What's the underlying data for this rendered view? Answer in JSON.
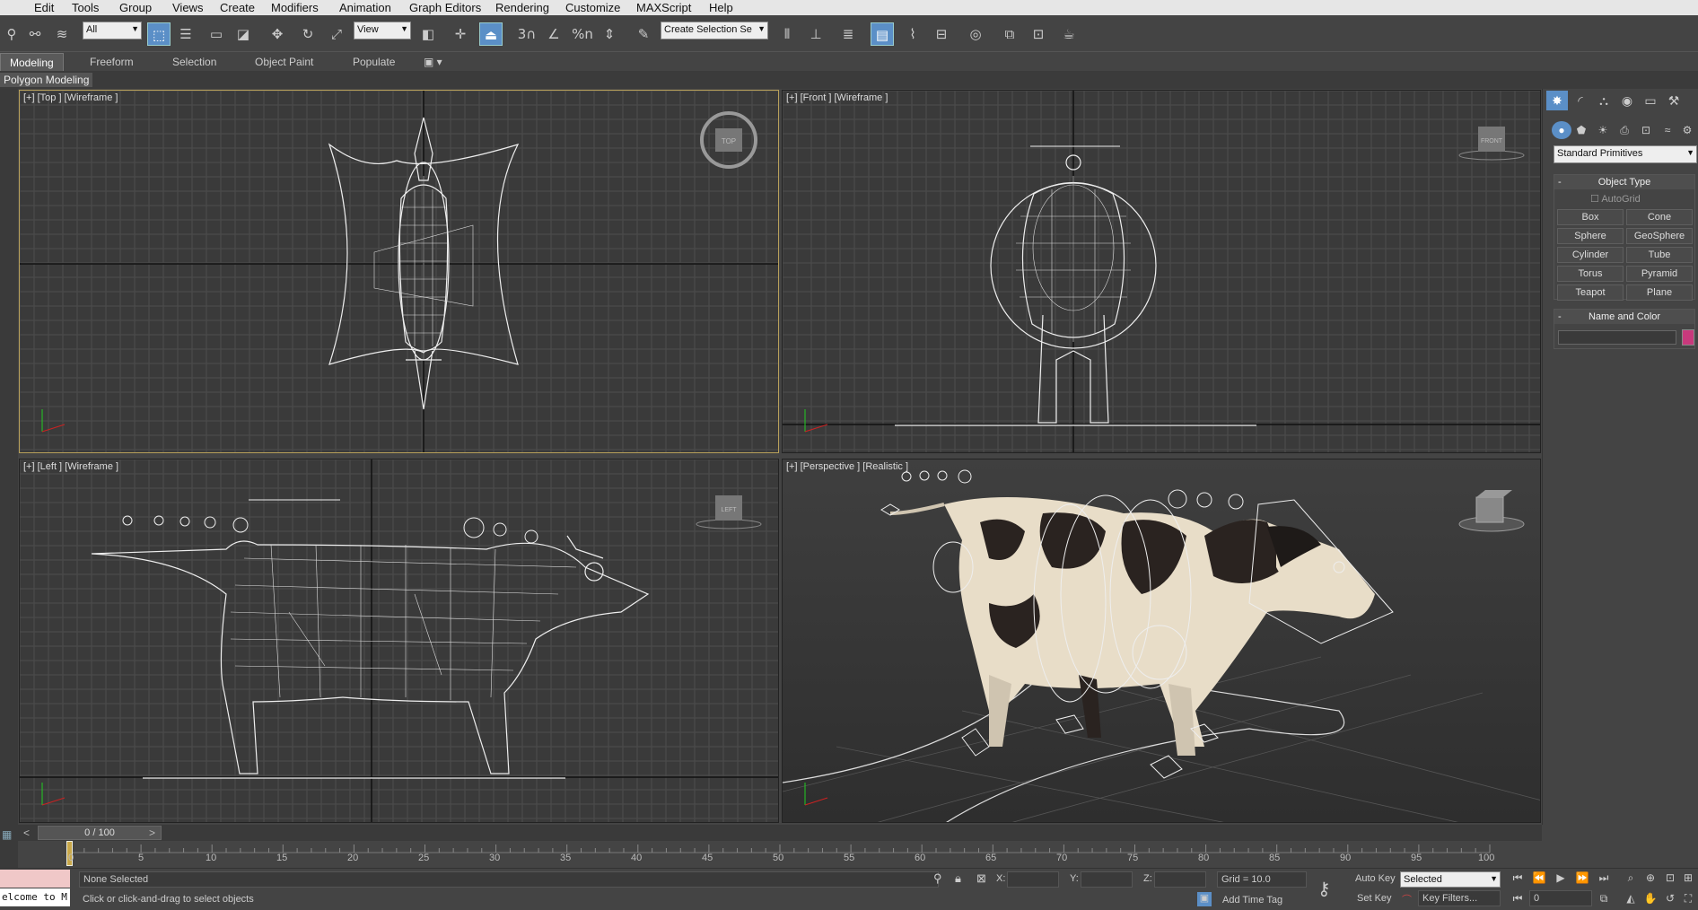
{
  "menu": [
    "Edit",
    "Tools",
    "Group",
    "Views",
    "Create",
    "Modifiers",
    "Animation",
    "Graph Editors",
    "Rendering",
    "Customize",
    "MAXScript",
    "Help"
  ],
  "toolbar": {
    "selection_filter": "All",
    "ref_coord": "View",
    "selection_set_placeholder": "Create Selection Se",
    "snap_label": "3",
    "percent_label": "%n"
  },
  "ribbon": {
    "tabs": [
      "Modeling",
      "Freeform",
      "Selection",
      "Object Paint",
      "Populate"
    ],
    "subpanel": "Polygon Modeling"
  },
  "viewports": {
    "top": {
      "label": "[+] [Top ] [Wireframe ]",
      "cube": "TOP"
    },
    "front": {
      "label": "[+] [Front ] [Wireframe ]",
      "cube": "FRONT"
    },
    "left": {
      "label": "[+] [Left ] [Wireframe ]",
      "cube": "LEFT"
    },
    "perspective": {
      "label": "[+] [Perspective ] [Realistic ]"
    }
  },
  "command_panel": {
    "category": "Standard Primitives",
    "object_type_title": "Object Type",
    "autogrid": "AutoGrid",
    "buttons": [
      "Box",
      "Cone",
      "Sphere",
      "GeoSphere",
      "Cylinder",
      "Tube",
      "Torus",
      "Pyramid",
      "Teapot",
      "Plane"
    ],
    "name_color_title": "Name and Color",
    "object_color": "#c8397c"
  },
  "timeline": {
    "frame": "0 / 100",
    "ticks": [
      "0",
      "5",
      "10",
      "15",
      "20",
      "25",
      "30",
      "35",
      "40",
      "45",
      "50",
      "55",
      "60",
      "65",
      "70",
      "75",
      "80",
      "85",
      "90",
      "95",
      "100"
    ]
  },
  "status": {
    "maxscript": "elcome to M",
    "selection": "None Selected",
    "prompt": "Click or click-and-drag to select objects",
    "x_label": "X:",
    "y_label": "Y:",
    "z_label": "Z:",
    "grid": "Grid = 10.0",
    "add_time_tag": "Add Time Tag",
    "auto_key": "Auto Key",
    "set_key": "Set Key",
    "key_mode": "Selected",
    "key_filters": "Key Filters...",
    "current_frame": "0"
  },
  "colors": {
    "accent": "#5b8fc7",
    "active_viewport_border": "#b8a05a"
  }
}
